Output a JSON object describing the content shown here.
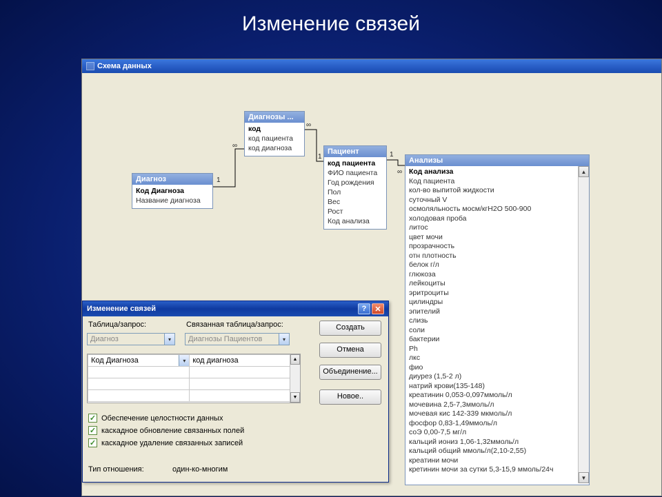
{
  "slide": {
    "title": "Изменение связей"
  },
  "schema_window": {
    "title": "Схема данных"
  },
  "tables": {
    "diagnoz": {
      "title": "Диагноз",
      "fields": [
        "Код Диагноза",
        "Название диагноза"
      ]
    },
    "diagnozy": {
      "title": "Диагнозы ...",
      "fields": [
        "код",
        "код пациента",
        "код диагноза"
      ]
    },
    "patient": {
      "title": "Пациент",
      "fields": [
        "код пациента",
        "ФИО пациента",
        "Год рождения",
        "Пол",
        "Вес",
        "Рост",
        "Код анализа"
      ]
    },
    "analizy": {
      "title": "Анализы",
      "fields": [
        "Код анализа",
        "Код пациента",
        "кол-во выпитой жидкости",
        "суточный V",
        "осмоляльность мосм/кгН2О 500-900",
        "холодовая проба",
        "литос",
        "цвет мочи",
        "прозрачность",
        "отн плотность",
        "белок г/л",
        "глюкоза",
        "лейкоциты",
        "эритроциты",
        "цилиндры",
        "эпителий",
        "слизь",
        "соли",
        "бактерии",
        "Ph",
        "лкс",
        "фио",
        "диурез (1,5-2 л)",
        "натрий крови(135-148)",
        "креатинин 0,053-0,097ммоль/л",
        "мочевина 2,5-7,3ммоль/л",
        "мочевая кис 142-339 мкмоль/л",
        "фосфор 0,83-1,49ммоль/л",
        "соЭ 0,00-7,5 мг/л",
        "кальций иониз 1,06-1,32ммоль/л",
        "кальций общий ммоль/л(2,10-2,55)",
        "креатини мочи",
        "кретинин мочи за сутки 5,3-15,9 ммоль/24ч"
      ]
    }
  },
  "cardinality": {
    "one": "1",
    "many": "∞"
  },
  "dialog": {
    "title": "Изменение связей",
    "labels": {
      "table_query": "Таблица/запрос:",
      "related_table_query": "Связанная таблица/запрос:",
      "relation_type": "Тип отношения:"
    },
    "combos": {
      "left": "Диагноз",
      "right": "Диагнозы Пациентов"
    },
    "grid": {
      "left0": "Код Диагноза",
      "right0": "код диагноза"
    },
    "checks": {
      "integrity": "Обеспечение целостности данных",
      "cascade_update": "каскадное обновление связанных полей",
      "cascade_delete": "каскадное удаление связанных записей"
    },
    "buttons": {
      "create": "Создать",
      "cancel": "Отмена",
      "join": "Объединение...",
      "new": "Новое.."
    },
    "relation_value": "один-ко-многим"
  }
}
